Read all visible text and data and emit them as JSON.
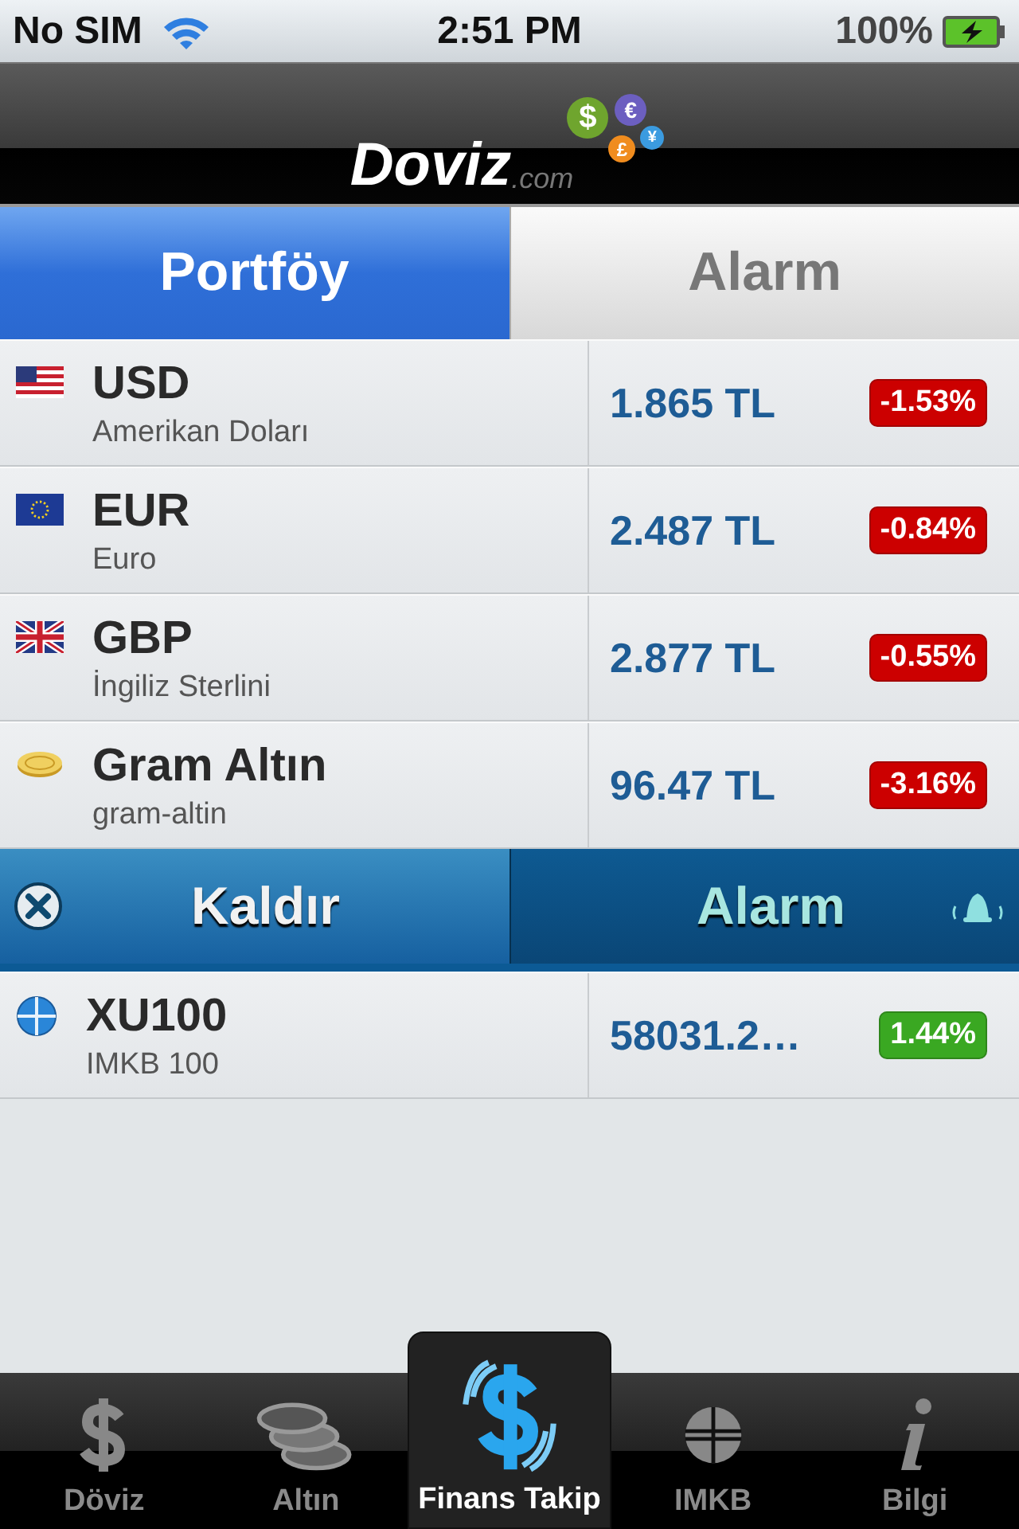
{
  "status_bar": {
    "carrier": "No SIM",
    "time": "2:51 PM",
    "battery": "100%"
  },
  "nav_bar": {
    "logo_text": "Doviz",
    "logo_suffix": ".com",
    "coins": [
      "$",
      "€",
      "£",
      "¥"
    ]
  },
  "segments": [
    {
      "label": "Portföy",
      "selected": true
    },
    {
      "label": "Alarm",
      "selected": false
    }
  ],
  "rows": [
    {
      "kind": "quote",
      "code": "USD",
      "name": "Amerikan Doları",
      "price": "1.865 TL",
      "change": "-1.53%",
      "color": "#cc0000"
    },
    {
      "kind": "quote",
      "code": "EUR",
      "name": "Euro",
      "price": "2.487 TL",
      "change": "-0.84%",
      "color": "#cc0000"
    },
    {
      "kind": "quote",
      "code": "GBP",
      "name": "İngiliz Sterlini",
      "price": "2.877 TL",
      "change": "-0.55%",
      "color": "#cc0000"
    },
    {
      "kind": "quote",
      "code": "Gram Altın",
      "name": "gram-altin",
      "price": "96.47 TL",
      "change": "-3.16%",
      "color": "#cc0000"
    },
    {
      "kind": "actions",
      "remove": "Kaldır",
      "alarm": "Alarm"
    },
    {
      "kind": "quote",
      "code": "XU100",
      "name": "IMKB 100",
      "price": "58031.2…",
      "change": "1.44%",
      "color": "#3aa822"
    }
  ],
  "tab_bar": [
    {
      "label": "Döviz",
      "selected": false
    },
    {
      "label": "Altın",
      "selected": false
    },
    {
      "label": "Finans Takip",
      "selected": true
    },
    {
      "label": "IMKB",
      "selected": false
    },
    {
      "label": "Bilgi",
      "selected": false
    }
  ]
}
